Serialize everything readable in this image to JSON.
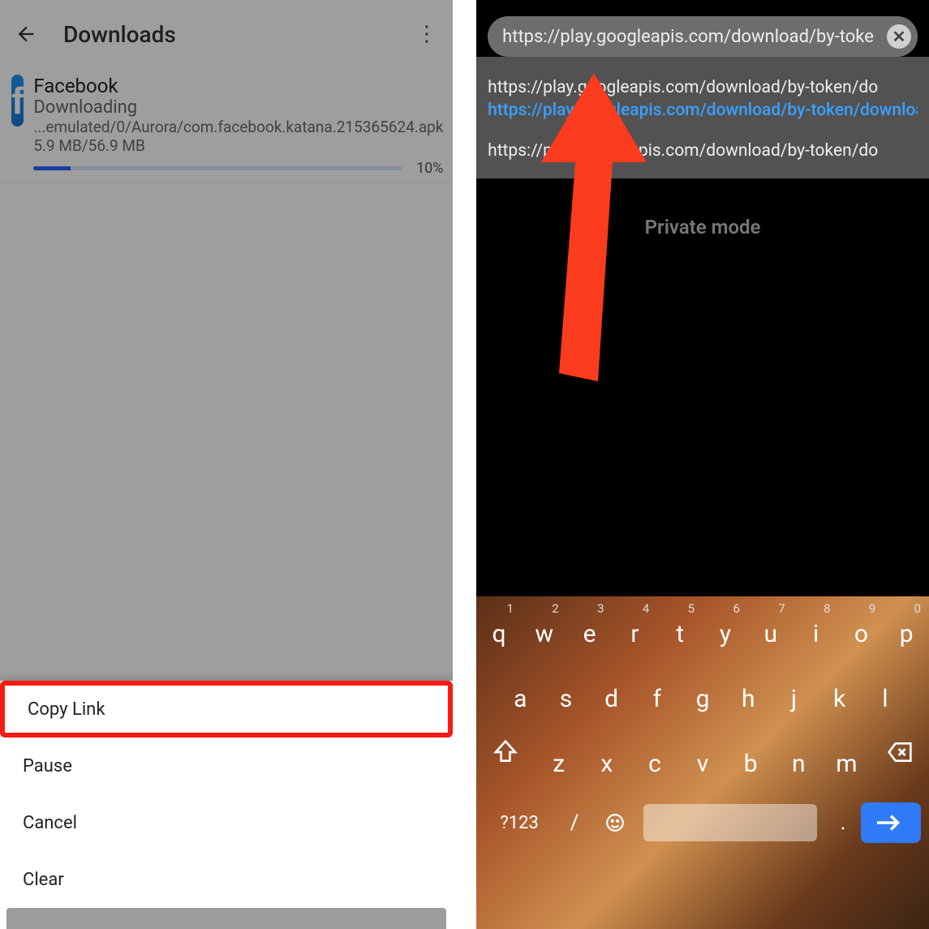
{
  "left": {
    "appbar": {
      "title": "Downloads"
    },
    "download": {
      "name": "Facebook",
      "status": "Downloading",
      "path": "...emulated/0/Aurora/com.facebook.katana.215365624.apk",
      "size": "5.9 MB/56.9 MB",
      "percent_text": "10%",
      "percent": 10
    },
    "sheet": {
      "copy_link": "Copy Link",
      "pause": "Pause",
      "cancel": "Cancel",
      "clear": "Clear"
    }
  },
  "right": {
    "omnibox": "https://play.googleapis.com/download/by-toke",
    "suggestions": {
      "a": "https://play.googleapis.com/download/by-token/do",
      "b": "https://play.googleapis.com/download/by-token/downloa",
      "c": "https://play.googleapis.com/download/by-token/do"
    },
    "private_mode": "Private mode",
    "keyboard": {
      "row1": [
        "q",
        "w",
        "e",
        "r",
        "t",
        "y",
        "u",
        "i",
        "o",
        "p"
      ],
      "nums": [
        "1",
        "2",
        "3",
        "4",
        "5",
        "6",
        "7",
        "8",
        "9",
        "0"
      ],
      "row2": [
        "a",
        "s",
        "d",
        "f",
        "g",
        "h",
        "j",
        "k",
        "l"
      ],
      "row3": [
        "z",
        "x",
        "c",
        "v",
        "b",
        "n",
        "m"
      ],
      "sym": "?123",
      "slash": "/",
      "dot": "."
    }
  }
}
